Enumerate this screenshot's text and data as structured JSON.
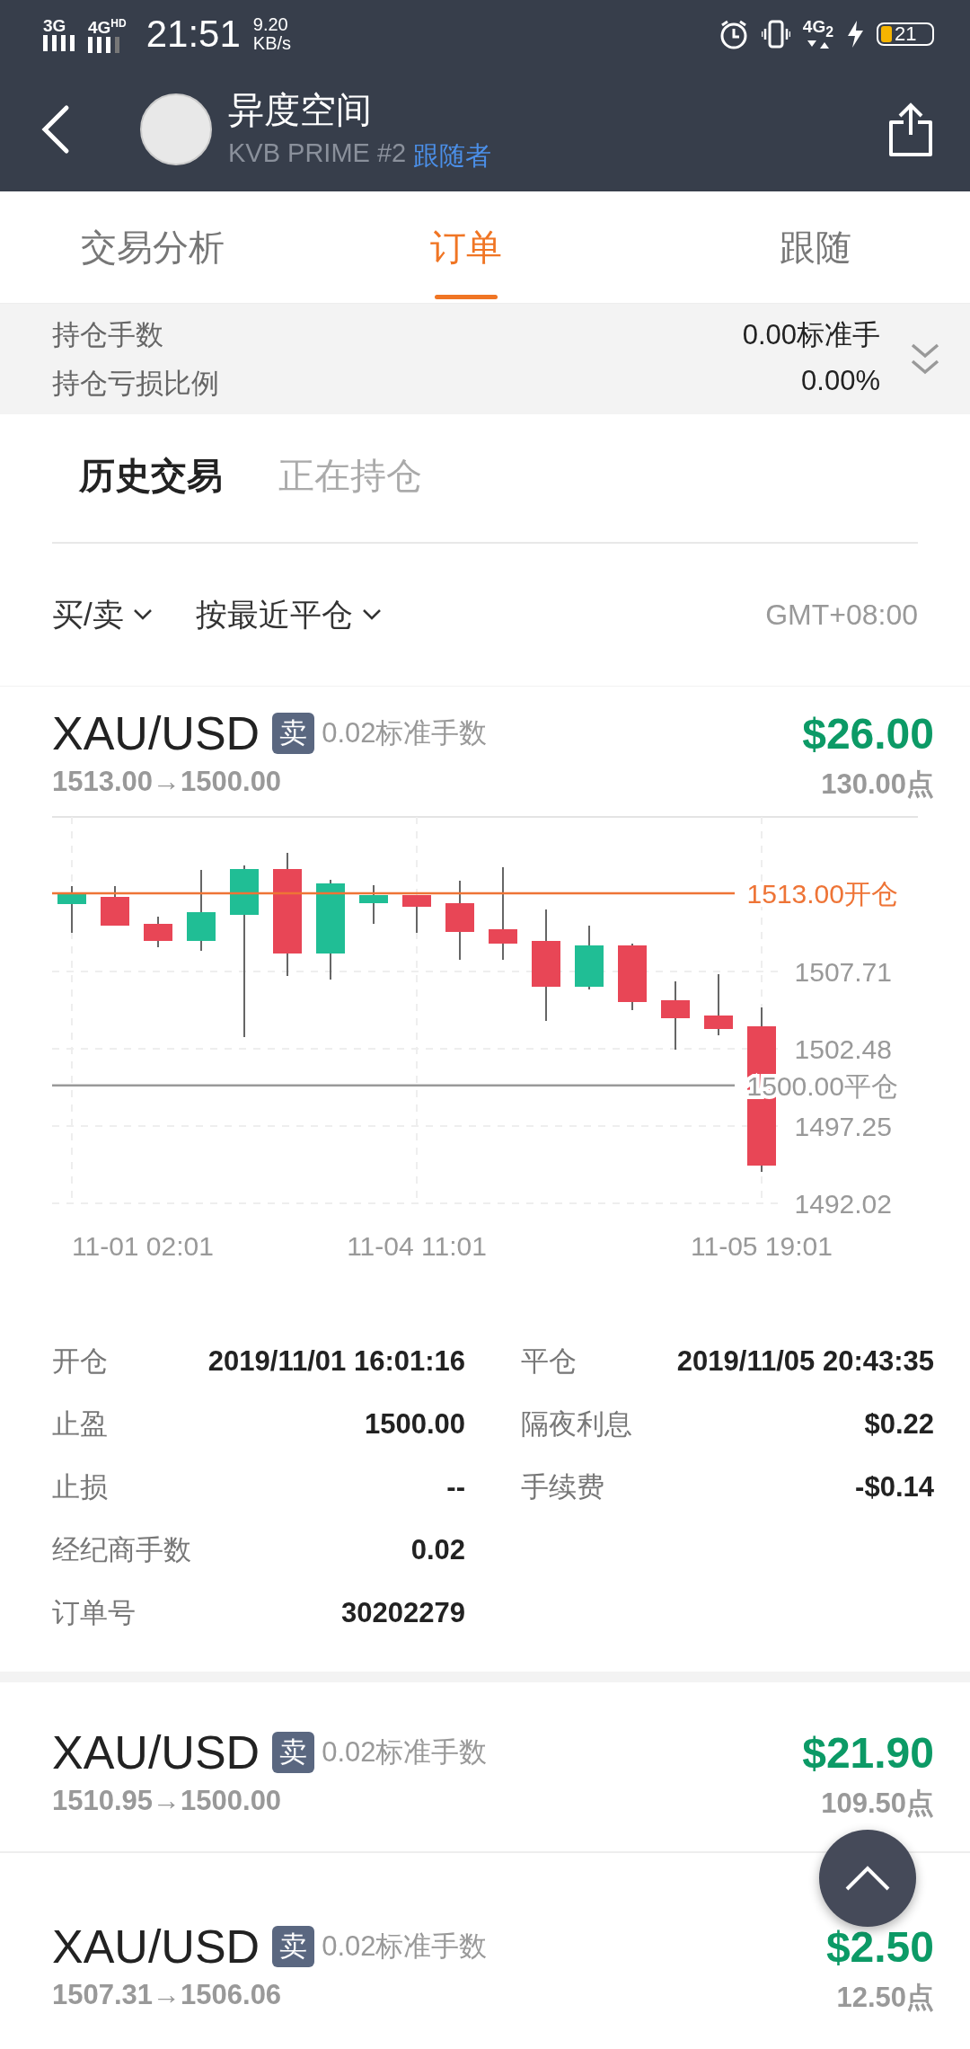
{
  "status_bar": {
    "signal_1": "3G",
    "signal_2": "4G",
    "signal_2_tag": "HD",
    "time": "21:51",
    "speed": "9.20",
    "speed_unit": "KB/s",
    "network": "4G",
    "network_sub": "2",
    "battery": "21"
  },
  "header": {
    "name": "异度空间",
    "account": "KVB PRIME #2",
    "role": "跟随者"
  },
  "tabs": [
    {
      "label": "交易分析",
      "selected": false
    },
    {
      "label": "订单",
      "selected": true
    },
    {
      "label": "跟随",
      "selected": false
    }
  ],
  "summary": {
    "expanded": false,
    "rows": [
      {
        "label": "持仓手数",
        "value": "0.00标准手"
      },
      {
        "label": "持仓亏损比例",
        "value": "0.00%"
      }
    ]
  },
  "sub_tabs": [
    {
      "label": "历史交易",
      "selected": true
    },
    {
      "label": "正在持仓",
      "selected": false
    }
  ],
  "filters": [
    {
      "label": "买/卖"
    },
    {
      "label": "按最近平仓"
    }
  ],
  "timezone": "GMT+08:00",
  "orders": [
    {
      "symbol": "XAU/USD",
      "side": "卖",
      "lots": "0.02标准手数",
      "profit": "$26.00",
      "prices": "1513.00→1500.00",
      "points": "130.00点",
      "chart_data": {
        "type": "bar",
        "categories": [
          "11-01 02:01",
          null,
          null,
          null,
          null,
          null,
          null,
          null,
          "11-04 11:01",
          null,
          null,
          null,
          null,
          null,
          null,
          null,
          "11-05 19:01"
        ],
        "ylim": [
          1492.02,
          1518.17
        ],
        "yticks": [
          {
            "value": 1507.71,
            "label": "1507.71"
          },
          {
            "value": 1502.48,
            "label": "1502.48"
          },
          {
            "value": 1497.25,
            "label": "1497.25"
          },
          {
            "value": 1492.02,
            "label": "1492.02"
          }
        ],
        "grid": true,
        "ref_lines": [
          {
            "axis": "y",
            "value": 1513,
            "label": "1513.00开仓",
            "color": "#ee7436"
          },
          {
            "axis": "y",
            "value": 1500,
            "label": "1500.00平仓",
            "color": "#999999"
          }
        ]
      },
      "details": [
        [
          {
            "label": "开仓",
            "value": "2019/11/01 16:01:16"
          },
          {
            "label": "平仓",
            "value": "2019/11/05 20:43:35"
          }
        ],
        [
          {
            "label": "止盈",
            "value": "1500.00"
          },
          {
            "label": "隔夜利息",
            "value": "$0.22"
          }
        ],
        [
          {
            "label": "止损",
            "value": "--"
          },
          {
            "label": "手续费",
            "value": "-$0.14"
          }
        ],
        [
          {
            "label": "经纪商手数",
            "value": "0.02"
          }
        ],
        [
          {
            "label": "订单号",
            "value": "30202279"
          }
        ]
      ]
    },
    {
      "symbol": "XAU/USD",
      "side": "卖",
      "lots": "0.02标准手数",
      "profit": "$21.90",
      "prices": "1510.95→1500.00",
      "points": "109.50点"
    },
    {
      "symbol": "XAU/USD",
      "side": "卖",
      "lots": "0.02标准手数",
      "profit": "$2.50",
      "prices": "1507.31→1506.06",
      "points": "12.50点"
    }
  ]
}
